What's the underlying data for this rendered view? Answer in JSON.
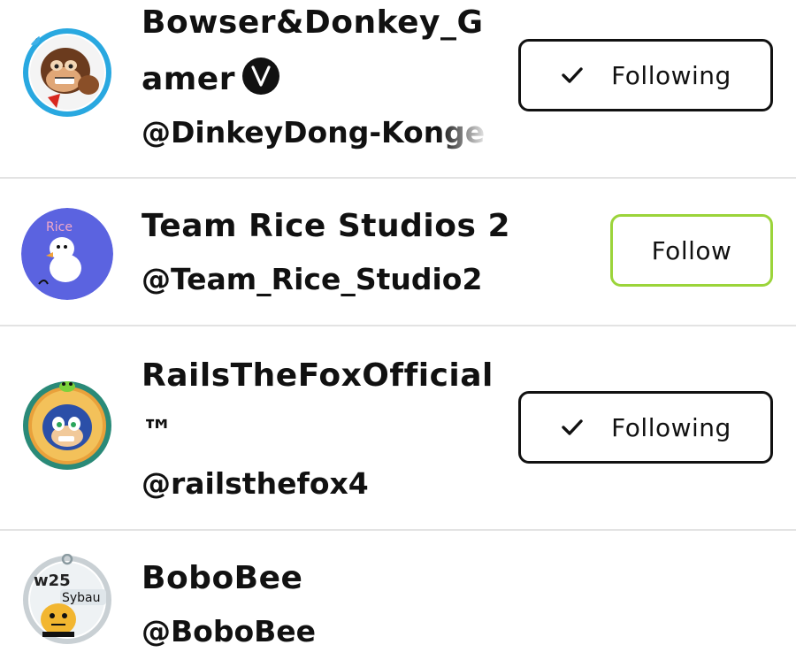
{
  "users": [
    {
      "name": "Bowser&Donkey_Gamer",
      "verified": true,
      "handle": "@DinkeyDong-Konge",
      "button_label": "Following",
      "button_state": "following",
      "avatar_icon": "donkey-kong-avatar",
      "avatar_ring": "#29a8e0"
    },
    {
      "name": "Team Rice Studios 2",
      "verified": false,
      "handle": "@Team_Rice_Studio2",
      "button_label": "Follow",
      "button_state": "not-following",
      "avatar_icon": "white-bird-avatar",
      "avatar_bg": "#5b63e0"
    },
    {
      "name": "RailsTheFoxOfficial™",
      "verified": false,
      "handle": "@railsthefox4",
      "button_label": "Following",
      "button_state": "following",
      "avatar_icon": "blue-fox-avatar",
      "avatar_ring": "#2a8a78"
    },
    {
      "name": "BoboBee",
      "verified": false,
      "handle": "@BoboBee",
      "button_label": "",
      "button_state": "hidden",
      "avatar_icon": "bee-avatar",
      "avatar_ring": "#c9d0d4"
    }
  ],
  "colors": {
    "follow_border": "#9bd43a",
    "following_border": "#111111",
    "divider": "#e3e3e3"
  },
  "avatar_texts": {
    "team_rice": "Rice",
    "bobobee_badge": "Sybau"
  }
}
